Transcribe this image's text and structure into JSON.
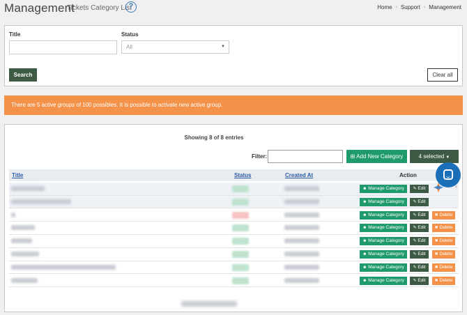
{
  "header": {
    "title": "Management",
    "subtitle": "Tickets Category List",
    "help_icon": "question-circle-icon",
    "breadcrumb": [
      "Home",
      "Support",
      "Management"
    ]
  },
  "filters": {
    "title_label": "Title",
    "title_value": "",
    "status_label": "Status",
    "status_value": "All",
    "search_label": "Search",
    "clear_label": "Clear all"
  },
  "alert": {
    "text": "There are 5 active groups of 100 possibles. It is possible to activate new active group.",
    "color": "#f4924a"
  },
  "table": {
    "showing": "Showing 8 of 8 entries",
    "filter_label": "Filter:",
    "filter_value": "",
    "add_label": "Add New Category",
    "selected_label": "4 selected",
    "columns": [
      "Title",
      "Status",
      "Created At",
      "Action"
    ],
    "action_labels": {
      "manage": "Manage Category",
      "edit": "Edit",
      "delete": "Delete"
    },
    "rows": [
      {
        "status": "active",
        "delete": false,
        "selected": true
      },
      {
        "status": "active",
        "delete": false,
        "selected": true
      },
      {
        "status": "inactive",
        "delete": true,
        "selected": false
      },
      {
        "status": "active",
        "delete": true,
        "selected": false
      },
      {
        "status": "active",
        "delete": true,
        "selected": false
      },
      {
        "status": "active",
        "delete": true,
        "selected": false
      },
      {
        "status": "active",
        "delete": true,
        "selected": false
      },
      {
        "status": "active",
        "delete": true,
        "selected": false
      }
    ]
  },
  "colors": {
    "primary_green": "#1f9a6c",
    "dark_green": "#3d5a45",
    "orange": "#f4924a",
    "link_blue": "#2a5aa8",
    "chat_blue": "#1a6fb8"
  }
}
